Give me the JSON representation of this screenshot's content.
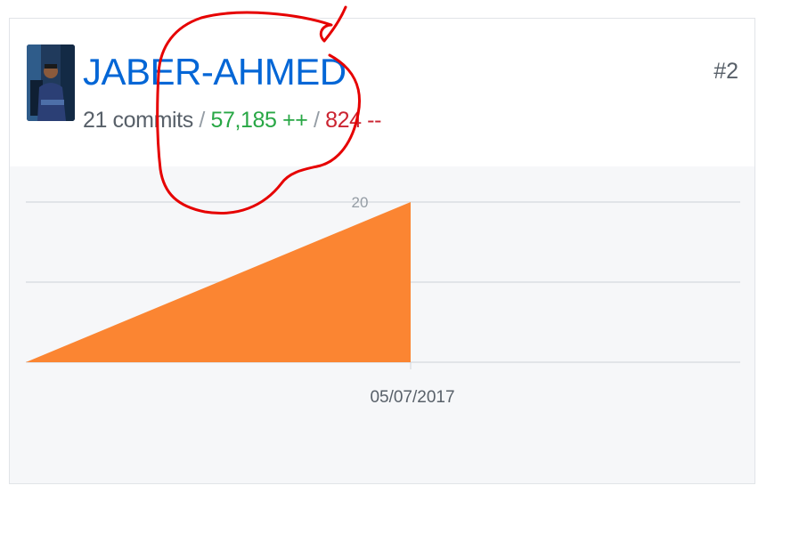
{
  "contributor": {
    "username": "JABER-AHMED",
    "rank": "#2",
    "commits_text": "21 commits",
    "separator": " / ",
    "additions_text": "57,185 ++",
    "deletions_text": "824 --"
  },
  "colors": {
    "link": "#0366d6",
    "additions": "#28a745",
    "deletions": "#cb2431",
    "area_fill": "#fb8532",
    "annotation": "#e60000"
  },
  "chart_data": {
    "type": "area",
    "x": [
      "",
      "05/07/2017"
    ],
    "series": [
      {
        "values": [
          0,
          20
        ]
      }
    ],
    "tick_labels_y": [
      "20"
    ],
    "tick_labels_x": [
      "05/07/2017"
    ],
    "ylim": [
      0,
      20
    ],
    "grid": true
  },
  "annotation": {
    "type": "hand-drawn red circle around username"
  }
}
